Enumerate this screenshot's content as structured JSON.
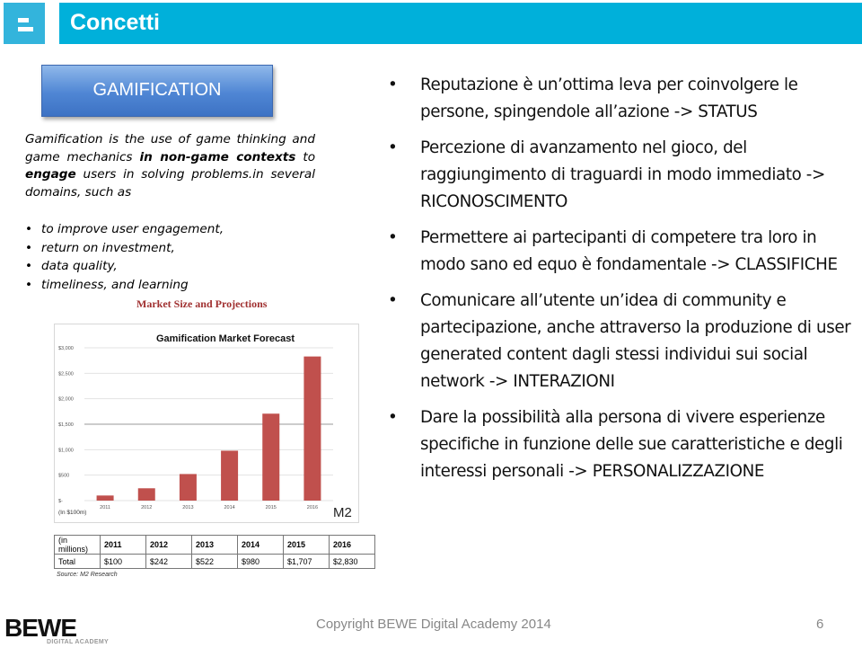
{
  "header": {
    "title": "Concetti",
    "icon": "menu-bars-icon"
  },
  "left": {
    "box_label": "GAMIFICATION",
    "definition": {
      "part1": "Gamification is the use of game thinking and game mechanics ",
      "bold1": "in non-game contexts",
      "part2": " to ",
      "bold2": "engage",
      "part3": " users in solving problems.in several domains, such as"
    },
    "uses": [
      "to improve user engagement,",
      "return on investment,",
      "data quality,",
      "timeliness, and learning"
    ]
  },
  "market": {
    "title": "Market Size and Projections",
    "table": {
      "header": [
        "(in millions)",
        "2011",
        "2012",
        "2013",
        "2014",
        "2015",
        "2016"
      ],
      "row": [
        "Total",
        "$100",
        "$242",
        "$522",
        "$980",
        "$1,707",
        "$2,830"
      ]
    },
    "source": "Source: M2 Research"
  },
  "chart_data": {
    "type": "bar",
    "title": "Gamification Market Forecast",
    "categories": [
      "2011",
      "2012",
      "2013",
      "2014",
      "2015",
      "2016"
    ],
    "values": [
      100,
      242,
      522,
      980,
      1707,
      2830
    ],
    "xlabel": "",
    "ylabel": "",
    "unit_note": "(In $100m)",
    "ylim": [
      0,
      3000
    ],
    "yticks": [
      0,
      500,
      1000,
      1500,
      2000,
      2500,
      3000
    ],
    "ytick_labels": [
      "$-",
      "$500",
      "$1,000",
      "$1,500",
      "$2,000",
      "$2,500",
      "$3,000"
    ],
    "grid": true,
    "bar_color": "#c0504d",
    "watermark": "M2"
  },
  "bullets": [
    "Reputazione è un’ottima leva per coinvolgere le persone, spingendole all’azione -> STATUS",
    "Percezione di avanzamento nel gioco, del raggiungimento di traguardi in modo immediato -> RICONOSCIMENTO",
    "Permettere ai partecipanti di competere tra loro in modo sano ed equo è fondamentale -> CLASSIFICHE",
    "Comunicare all’utente un’idea di community e partecipazione, anche attraverso la produzione di user generated content dagli stessi individui sui social network -> INTERAZIONI",
    "Dare la possibilità alla persona di vivere esperienze specifiche in funzione delle sue caratteristiche e degli interessi personali -> PERSONALIZZAZIONE"
  ],
  "footer": {
    "logo": "BEWE",
    "logo_sub": "DIGITAL ACADEMY",
    "copyright": "Copyright BEWE Digital Academy 2014",
    "page": "6"
  }
}
